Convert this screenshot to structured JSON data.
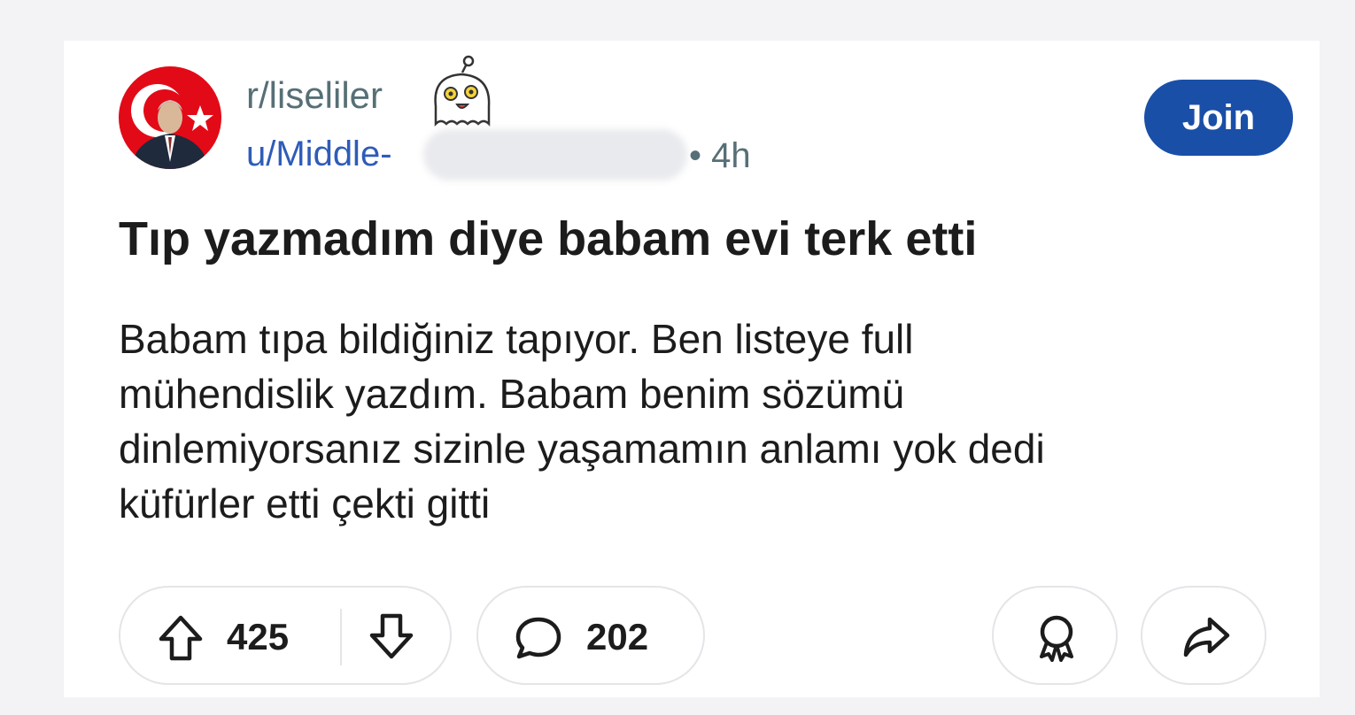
{
  "post": {
    "subreddit": "r/liseliler",
    "author_prefix": "u/Middle-",
    "time_separator": "•",
    "time": "4h",
    "join_label": "Join",
    "title": "Tıp yazmadım diye babam evi terk etti",
    "body_lines": [
      "Babam tıpa bildiğiniz tapıyor. Ben listeye full",
      "mühendislik yazdım. Babam benim sözümü",
      "dinlemiyorsanız sizinle yaşamamın anlamı yok dedi",
      "küfürler etti çekti gitti"
    ]
  },
  "actions": {
    "upvotes": "425",
    "comments": "202"
  },
  "icons": {
    "avatar": "subreddit-avatar",
    "snoo": "ghost-snoo-icon",
    "upvote": "upvote-arrow-icon",
    "downvote": "downvote-arrow-icon",
    "comment": "speech-bubble-icon",
    "award": "award-ribbon-icon",
    "share": "share-arrow-icon"
  },
  "colors": {
    "join_button": "#1a4fa8",
    "user_link": "#2e5cb8",
    "meta_text": "#576f76",
    "flag_red": "#e30a17"
  }
}
